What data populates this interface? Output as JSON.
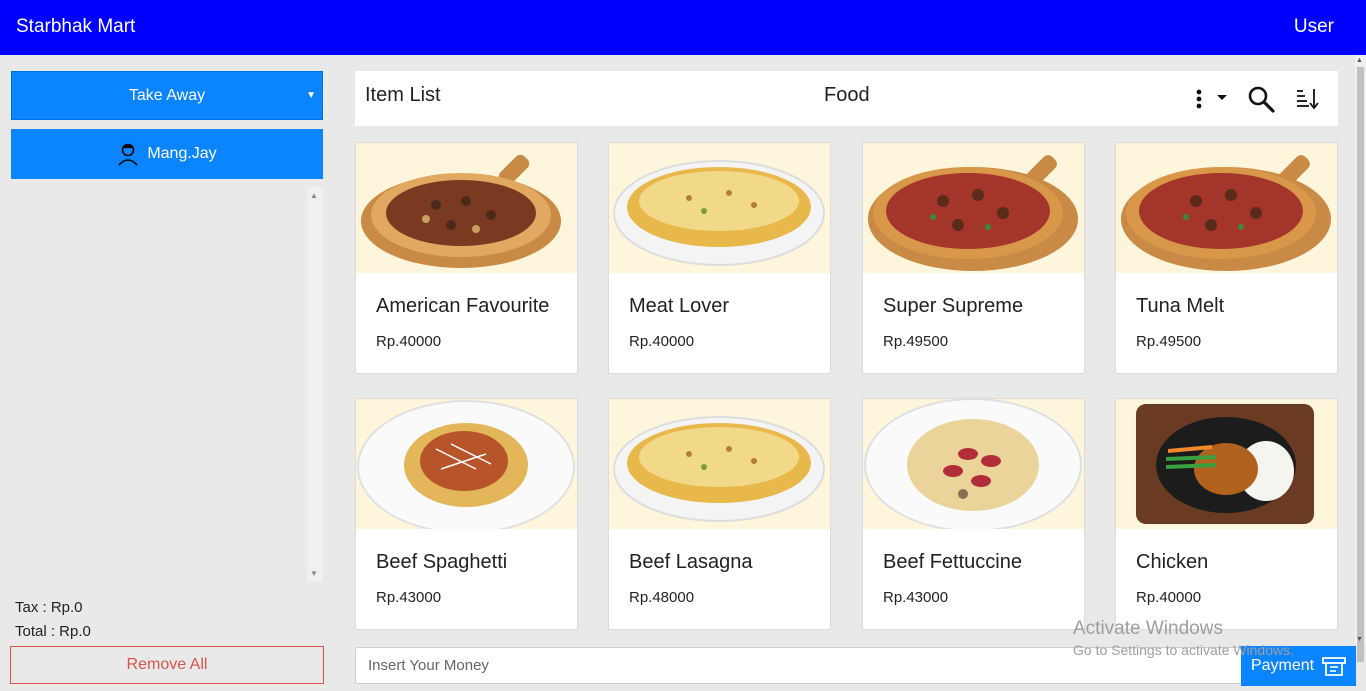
{
  "app": {
    "brand": "Starbhak Mart",
    "user": "User"
  },
  "sidebar": {
    "order_type": "Take Away",
    "customer": "Mang.Jay",
    "tax": "Tax : Rp.0",
    "total": "Total : Rp.0",
    "remove_all": "Remove All"
  },
  "catalog": {
    "title": "Item List",
    "category": "Food",
    "items": [
      {
        "name": "American Favourite",
        "price": "Rp.40000",
        "image": "pizza-edge"
      },
      {
        "name": "Meat Lover",
        "price": "Rp.40000",
        "image": "lasagna-dish"
      },
      {
        "name": "Super Supreme",
        "price": "Rp.49500",
        "image": "pizza"
      },
      {
        "name": "Tuna Melt",
        "price": "Rp.49500",
        "image": "pizza"
      },
      {
        "name": "Beef Spaghetti",
        "price": "Rp.43000",
        "image": "spaghetti-plate"
      },
      {
        "name": "Beef Lasagna",
        "price": "Rp.48000",
        "image": "lasagna-dish"
      },
      {
        "name": "Beef Fettuccine",
        "price": "Rp.43000",
        "image": "fettuccine-plate"
      },
      {
        "name": "Chicken",
        "price": "Rp.40000",
        "image": "chicken-hotplate"
      }
    ]
  },
  "payment": {
    "placeholder": "Insert Your Money",
    "button": "Payment"
  },
  "watermark": {
    "line1": "Activate Windows",
    "line2": "Go to Settings to activate Windows."
  },
  "colors": {
    "topbar": "#0000ff",
    "accent": "#0a84ff",
    "danger": "#d9534f"
  }
}
